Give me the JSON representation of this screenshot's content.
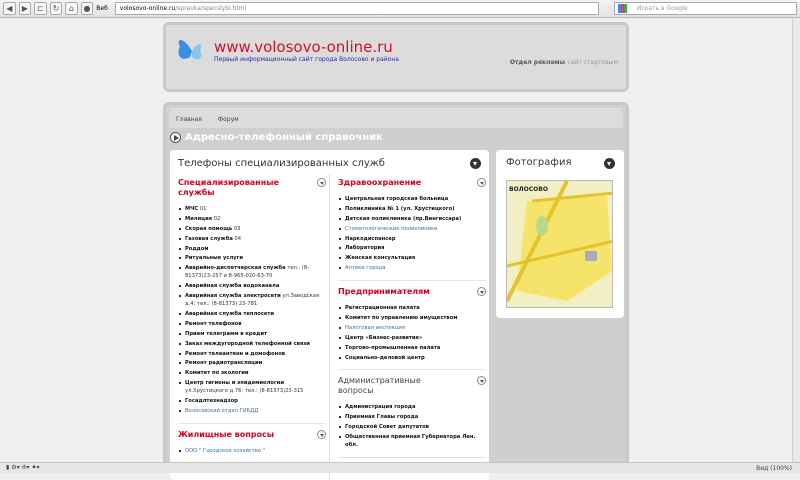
{
  "browser": {
    "back": "◀",
    "forward": "▶",
    "reload": "↻",
    "home": "⌂",
    "url_domain": "volosovo-online.ru",
    "url_path": "/spravka/specslybi.html",
    "site_label": "Веб",
    "search_placeholder": "Искать в Google",
    "zoom": "Вид (100%)"
  },
  "header": {
    "site_name": "www.volosovo-online.ru",
    "tagline": "Первый информационный сайт города Волосово и района",
    "ad_link": "Отдел рекламы",
    "start_link": "Сделать сайт стартовым"
  },
  "nav": {
    "items": [
      "Главная",
      "Форум"
    ]
  },
  "section_title": "Адресно-телефонный справочник",
  "left_card": {
    "title": "Телефоны специализированных служб",
    "col1": [
      {
        "title": "Специализированные службы",
        "style": "red",
        "items": [
          {
            "t": "МЧС",
            "x": " 01"
          },
          {
            "t": "Милиция",
            "x": " 02"
          },
          {
            "t": "Скорая помощь",
            "x": " 03"
          },
          {
            "t": "Газовая служба",
            "x": " 04"
          },
          {
            "t": "Роддом"
          },
          {
            "t": "Ритуальные услуги"
          },
          {
            "t": "Аварийно-диспетчерская служба",
            "x": " тел.: (8-81373)23-257 и 8-965-020-63-70"
          },
          {
            "t": "Аварийная служба водоканала"
          },
          {
            "t": "Аварийная служба электросети",
            "x": " ул.Заводская д.4; тел.: (8-81373) 23-781"
          },
          {
            "t": "Аварийная служба теплосети"
          },
          {
            "t": "Ремонт телефонов"
          },
          {
            "t": "Прием телеграмм в кредит"
          },
          {
            "t": "Заказ междугородной телефонной связи"
          },
          {
            "t": "Ремонт телеантенн и домофонов"
          },
          {
            "t": "Ремонт радиотрансляции"
          },
          {
            "t": "Комитет по экологии"
          },
          {
            "t": "Центр гигиены и эпидемиологии",
            "x": " ул.Хрустицкого д.76; тел.: (8-81373)23-315"
          },
          {
            "t": "Госадлтехнадзор"
          },
          {
            "t": "Волосовский отдел ГИБДД",
            "link": true
          }
        ]
      },
      {
        "title": "Жилищные вопросы",
        "style": "red",
        "items": [
          {
            "t": "ООО \" Городское хозяйство \"",
            "link": true
          }
        ]
      }
    ],
    "col2": [
      {
        "title": "Здравоохранение",
        "style": "red",
        "items": [
          {
            "t": "Центральная городская больница"
          },
          {
            "t": "Поликлиника № 1 (ул. Хрустицкого)"
          },
          {
            "t": "Детская поликлиника (пр.Вингиссара)"
          },
          {
            "t": "Стоматологические поликлиники",
            "link": true
          },
          {
            "t": "Наркодиспансер"
          },
          {
            "t": "Лаборатория"
          },
          {
            "t": "Женская консультация"
          },
          {
            "t": "Аптеки города",
            "link": true
          }
        ]
      },
      {
        "title": "Предпринимателям",
        "style": "red",
        "items": [
          {
            "t": "Регистрационная палата"
          },
          {
            "t": "Комитет по управлению имуществом"
          },
          {
            "t": "Налоговая инспекция",
            "link": true
          },
          {
            "t": "Центр «Бизнес-развитие»"
          },
          {
            "t": "Торгово-промышленная палата"
          },
          {
            "t": "Социально-деловой центр"
          }
        ]
      },
      {
        "title": "Административные вопросы",
        "style": "gray",
        "items": [
          {
            "t": "Администрация города"
          },
          {
            "t": "Приемная Главы города"
          },
          {
            "t": "Городской Совет депутатов"
          },
          {
            "t": "Общественная приемная Губернатора Лен. обл."
          }
        ]
      }
    ]
  },
  "right_card": {
    "title": "Фотография",
    "map_label": "ВОЛОСОВО"
  }
}
